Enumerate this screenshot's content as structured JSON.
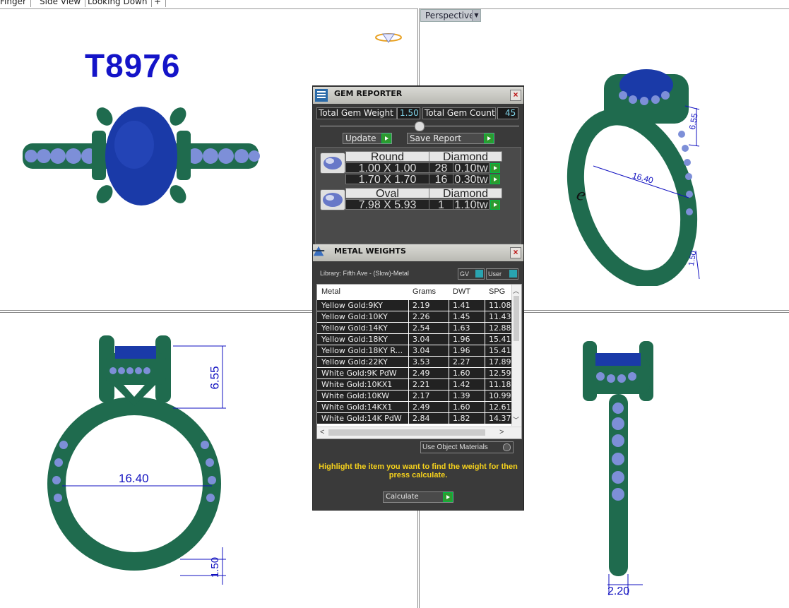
{
  "tabs": [
    "Finger",
    "Side View",
    "Looking Down"
  ],
  "tab_add": "+",
  "viewport_menu": {
    "label": "Perspective"
  },
  "model_title": "T8976",
  "engraving": "e",
  "dimensions": {
    "top_right_height": "6.55",
    "top_right_diameter": "16.40",
    "top_right_band": "1.50",
    "front_height": "6.55",
    "front_diameter": "16.40",
    "front_band": "1.50",
    "side_width": "2.20"
  },
  "gem_reporter": {
    "title": "GEM REPORTER",
    "total_weight_label": "Total Gem Weight",
    "total_weight_value": "1.50",
    "total_count_label": "Total Gem Count",
    "total_count_value": "45",
    "update_label": "Update",
    "save_label": "Save Report",
    "groups": [
      {
        "shape": "Round",
        "material": "Diamond",
        "rows": [
          {
            "size": "1.00 X 1.00",
            "count": "28",
            "weight": "0.10tw"
          },
          {
            "size": "1.70 X 1.70",
            "count": "16",
            "weight": "0.30tw"
          }
        ]
      },
      {
        "shape": "Oval",
        "material": "Diamond",
        "rows": [
          {
            "size": "7.98 X 5.93",
            "count": "1",
            "weight": "1.10tw"
          }
        ]
      }
    ]
  },
  "metal_weights": {
    "title": "METAL WEIGHTS",
    "library": "Library: Fifth Ave - (Slow)-Metal",
    "gv_label": "GV",
    "user_label": "User",
    "columns": [
      "Metal",
      "Grams",
      "DWT",
      "SPG"
    ],
    "rows": [
      [
        "Yellow Gold:9KY",
        "2.19",
        "1.41",
        "11.08"
      ],
      [
        "Yellow Gold:10KY",
        "2.26",
        "1.45",
        "11.43"
      ],
      [
        "Yellow Gold:14KY",
        "2.54",
        "1.63",
        "12.88"
      ],
      [
        "Yellow Gold:18KY",
        "3.04",
        "1.96",
        "15.41"
      ],
      [
        "Yellow Gold:18KY R...",
        "3.04",
        "1.96",
        "15.41"
      ],
      [
        "Yellow Gold:22KY",
        "3.53",
        "2.27",
        "17.89"
      ],
      [
        "White Gold:9K PdW",
        "2.49",
        "1.60",
        "12.59"
      ],
      [
        "White Gold:10KX1",
        "2.21",
        "1.42",
        "11.18"
      ],
      [
        "White Gold:10KW",
        "2.17",
        "1.39",
        "10.99"
      ],
      [
        "White Gold:14KX1",
        "2.49",
        "1.60",
        "12.61"
      ],
      [
        "White Gold:14K PdW",
        "2.84",
        "1.82",
        "14.37"
      ]
    ],
    "use_object_materials": "Use Object Materials",
    "hint": "Highlight the item you want to find the weight for then press calculate.",
    "calculate_label": "Calculate"
  },
  "colors": {
    "metal": "#1f6b4e",
    "gem": "#1a3aa8",
    "accent_gem": "#7d8fd8",
    "dim": "#1010c0"
  }
}
